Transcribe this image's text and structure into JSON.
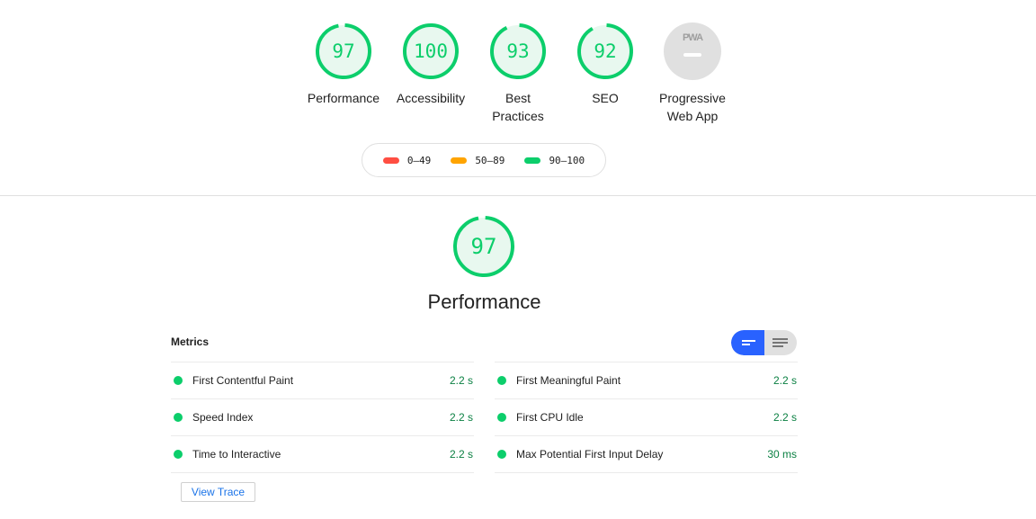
{
  "categories": [
    {
      "label": "Performance",
      "score": "97",
      "value": 97,
      "color": "#0cce6b"
    },
    {
      "label": "Accessibility",
      "score": "100",
      "value": 100,
      "color": "#0cce6b"
    },
    {
      "label": "Best\nPractices",
      "score": "93",
      "value": 93,
      "color": "#0cce6b"
    },
    {
      "label": "SEO",
      "score": "92",
      "value": 92,
      "color": "#0cce6b"
    },
    {
      "label": "Progressive\nWeb App",
      "badge": "PWA",
      "icon": "pwa-badge-icon"
    }
  ],
  "legend": [
    {
      "range": "0–49",
      "color": "#ff4e42"
    },
    {
      "range": "50–89",
      "color": "#ffa400"
    },
    {
      "range": "90–100",
      "color": "#0cce6b"
    }
  ],
  "performance": {
    "score": "97",
    "value": 97,
    "title": "Performance",
    "metrics_title": "Metrics",
    "toggle": {
      "active": "opportunity-view-icon",
      "inactive": "list-view-icon"
    },
    "metrics_left": [
      {
        "name": "First Contentful Paint",
        "value": "2.2 s"
      },
      {
        "name": "Speed Index",
        "value": "2.2 s"
      },
      {
        "name": "Time to Interactive",
        "value": "2.2 s"
      }
    ],
    "metrics_right": [
      {
        "name": "First Meaningful Paint",
        "value": "2.2 s"
      },
      {
        "name": "First CPU Idle",
        "value": "2.2 s"
      },
      {
        "name": "Max Potential First Input Delay",
        "value": "30 ms"
      }
    ],
    "view_trace_label": "View Trace"
  },
  "colors": {
    "pass": "#0cce6b",
    "pass_text": "#0b8043",
    "accent": "#2962ff",
    "link": "#1a73e8"
  }
}
